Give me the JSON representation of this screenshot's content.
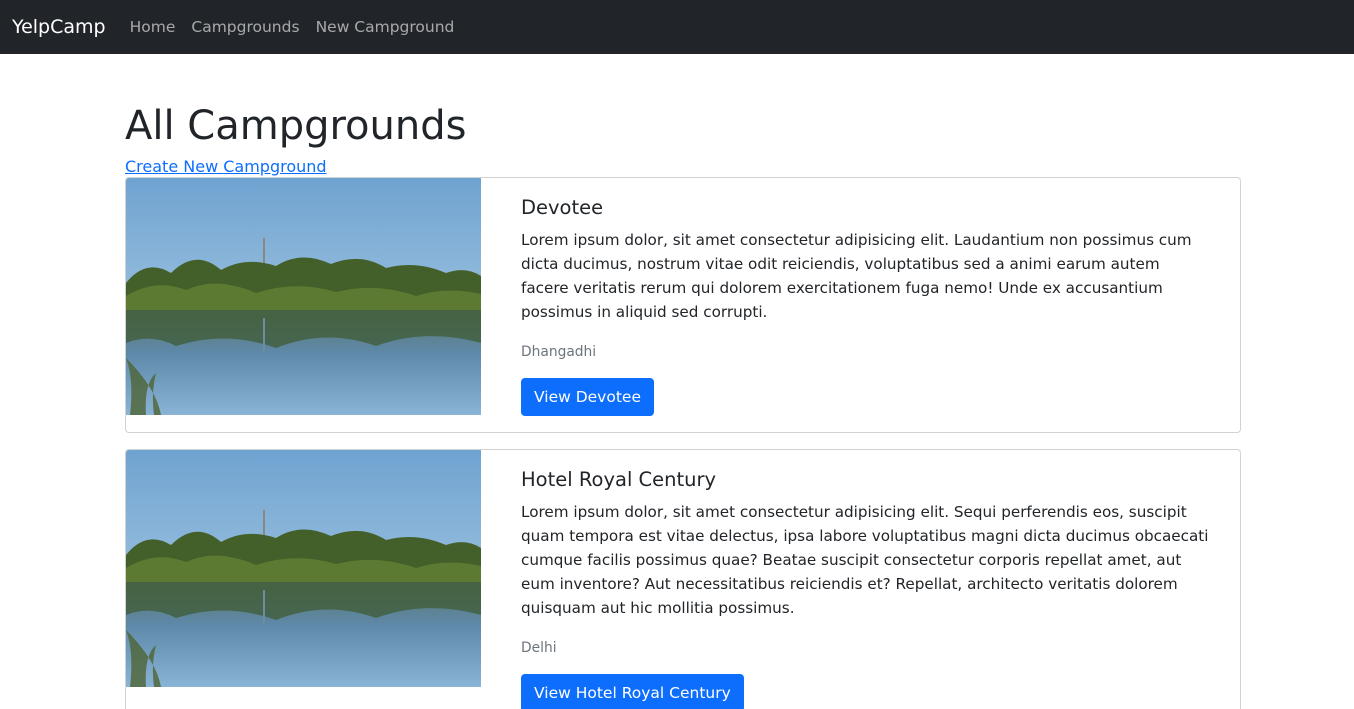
{
  "navbar": {
    "brand": "YelpCamp",
    "links": [
      {
        "label": "Home"
      },
      {
        "label": "Campgrounds"
      },
      {
        "label": "New Campground"
      }
    ]
  },
  "main": {
    "title": "All Campgrounds",
    "create_link": "Create New Campground",
    "campgrounds": [
      {
        "title": "Devotee",
        "description": "Lorem ipsum dolor, sit amet consectetur adipisicing elit. Laudantium non possimus cum dicta ducimus, nostrum vitae odit reiciendis, voluptatibus sed a animi earum autem facere veritatis rerum qui dolorem exercitationem fuga nemo! Unde ex accusantium possimus in aliquid sed corrupti.",
        "location": "Dhangadhi",
        "button_label": "View Devotee"
      },
      {
        "title": "Hotel Royal Century",
        "description": "Lorem ipsum dolor, sit amet consectetur adipisicing elit. Sequi perferendis eos, suscipit quam tempora est vitae delectus, ipsa labore voluptatibus magni dicta ducimus obcaecati cumque facilis possimus quae? Beatae suscipit consectetur corporis repellat amet, aut eum inventore? Aut necessitatibus reiciendis et? Repellat, architecto veritatis dolorem quisquam aut hic mollitia possimus.",
        "location": "Delhi",
        "button_label": "View Hotel Royal Century"
      }
    ]
  },
  "colors": {
    "navbar_bg": "#212529",
    "link": "#0d6efd",
    "button": "#0d6efd",
    "muted": "#6c757d"
  }
}
